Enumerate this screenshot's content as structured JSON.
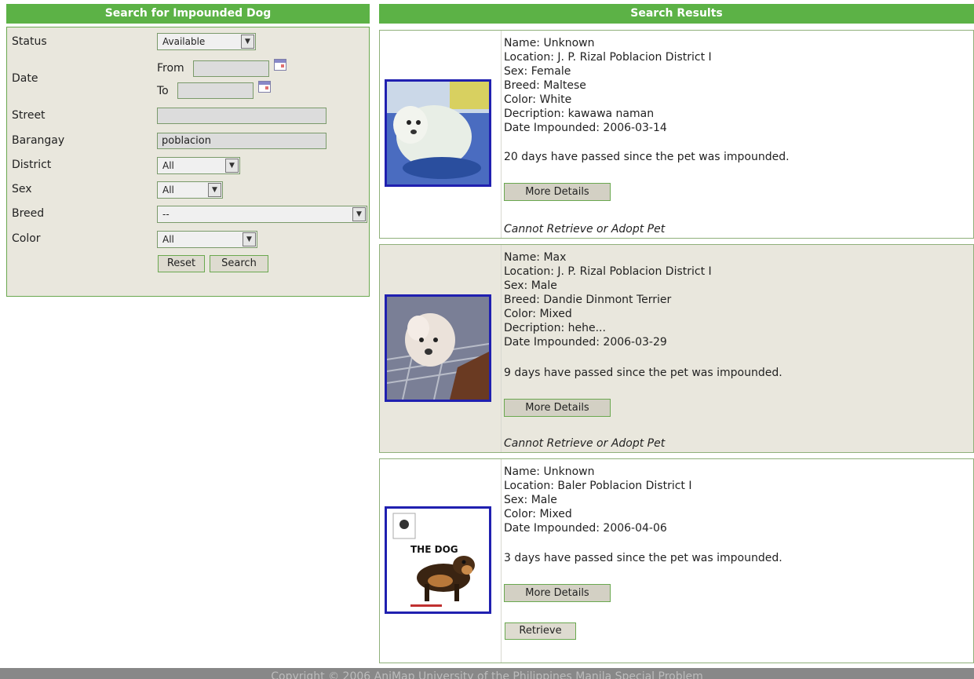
{
  "search": {
    "header": "Search for Impounded Dog",
    "fields": {
      "status_label": "Status",
      "status_value": "Available",
      "date_label": "Date",
      "from_label": "From",
      "to_label": "To",
      "from_value": "",
      "to_value": "",
      "street_label": "Street",
      "street_value": "",
      "barangay_label": "Barangay",
      "barangay_value": "poblacion",
      "district_label": "District",
      "district_value": "All",
      "sex_label": "Sex",
      "sex_value": "All",
      "breed_label": "Breed",
      "breed_value": "--",
      "color_label": "Color",
      "color_value": "All"
    },
    "reset_label": "Reset",
    "search_label": "Search"
  },
  "results": {
    "header": "Search Results",
    "items": [
      {
        "name": "Name: Unknown",
        "location": "Location: J. P. Rizal Poblacion District I",
        "sex": "Sex: Female",
        "breed": "Breed: Maltese",
        "color": "Color: White",
        "description": "Decription: kawawa naman",
        "date": "Date Impounded: 2006-03-14",
        "days": "20 days have passed since the pet was impounded.",
        "more": "More Details",
        "note": "Cannot Retrieve or Adopt Pet"
      },
      {
        "name": "Name: Max",
        "location": "Location: J. P. Rizal Poblacion District I",
        "sex": "Sex: Male",
        "breed": "Breed: Dandie Dinmont Terrier",
        "color": "Color: Mixed",
        "description": "Decription: hehe...",
        "date": "Date Impounded: 2006-03-29",
        "days": "9 days have passed since the pet was impounded.",
        "more": "More Details",
        "note": "Cannot Retrieve or Adopt Pet"
      },
      {
        "name": "Name: Unknown",
        "location": "Location: Baler Poblacion District I",
        "sex": "Sex: Male",
        "color": "Color: Mixed",
        "date": "Date Impounded: 2006-04-06",
        "days": "3 days have passed since the pet was impounded.",
        "more": "More Details",
        "retrieve": "Retrieve",
        "poster_title": "THE DOG"
      }
    ]
  },
  "footer": "Copyright © 2006 AniMap University of the Philippines Manila Special Problem",
  "icons": [
    "chevron-down-icon",
    "calendar-icon"
  ]
}
